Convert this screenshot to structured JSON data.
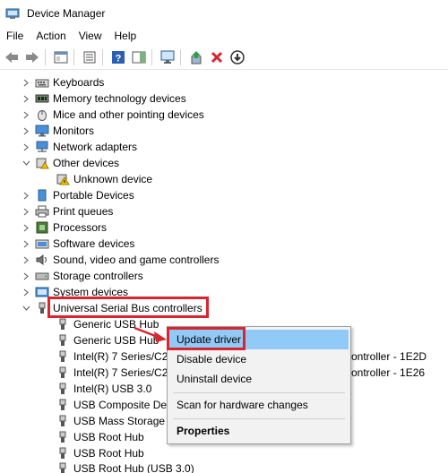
{
  "window": {
    "title": "Device Manager"
  },
  "menu": [
    "File",
    "Action",
    "View",
    "Help"
  ],
  "toolbar_icons": [
    "back-arrow-icon",
    "forward-arrow-icon",
    "properties-pane-icon",
    "list-icon",
    "help-icon",
    "action-pane-icon",
    "scan-monitor-icon",
    "update-driver-icon",
    "uninstall-x-icon",
    "disable-down-icon"
  ],
  "tree": {
    "items": [
      {
        "label": "Keyboards",
        "icon": "keyboard-icon"
      },
      {
        "label": "Memory technology devices",
        "icon": "memory-icon"
      },
      {
        "label": "Mice and other pointing devices",
        "icon": "mouse-icon"
      },
      {
        "label": "Monitors",
        "icon": "monitor-icon"
      },
      {
        "label": "Network adapters",
        "icon": "network-icon"
      },
      {
        "label": "Other devices",
        "icon": "other-devices-icon"
      },
      {
        "label": "Unknown device",
        "icon": "warning-device-icon"
      },
      {
        "label": "Portable Devices",
        "icon": "portable-icon"
      },
      {
        "label": "Print queues",
        "icon": "printer-icon"
      },
      {
        "label": "Processors",
        "icon": "processor-icon"
      },
      {
        "label": "Software devices",
        "icon": "software-icon"
      },
      {
        "label": "Sound, video and game controllers",
        "icon": "sound-icon"
      },
      {
        "label": "Storage controllers",
        "icon": "storage-icon"
      },
      {
        "label": "System devices",
        "icon": "system-icon"
      },
      {
        "label": "Universal Serial Bus controllers",
        "icon": "usb-icon"
      },
      {
        "label": "Generic USB Hub",
        "icon": "usb-plug-icon"
      },
      {
        "label": "Generic USB Hub",
        "icon": "usb-plug-icon"
      },
      {
        "label": "Intel(R) 7 Series/C216 Chipset Family USB Enhanced Host Controller - 1E2D",
        "icon": "usb-plug-icon"
      },
      {
        "label": "Intel(R) 7 Series/C216 Chipset Family USB Enhanced Host Controller - 1E26",
        "icon": "usb-plug-icon"
      },
      {
        "label": "Intel(R) USB 3.0",
        "icon": "usb-plug-icon"
      },
      {
        "label": "USB Composite Device",
        "icon": "usb-plug-icon"
      },
      {
        "label": "USB Mass Storage",
        "icon": "usb-plug-icon"
      },
      {
        "label": "USB Root Hub",
        "icon": "usb-plug-icon"
      },
      {
        "label": "USB Root Hub",
        "icon": "usb-plug-icon"
      },
      {
        "label": "USB Root Hub (USB 3.0)",
        "icon": "usb-plug-icon"
      }
    ],
    "visible_tails": {
      "row17": "ontroller - 1E2D",
      "row18": "ontroller - 1E26"
    }
  },
  "context_menu": {
    "update": "Update driver",
    "disable": "Disable device",
    "uninstall": "Uninstall device",
    "scan": "Scan for hardware changes",
    "properties": "Properties"
  },
  "colors": {
    "highlight": "#d9252d",
    "hover": "#91c9f7"
  }
}
